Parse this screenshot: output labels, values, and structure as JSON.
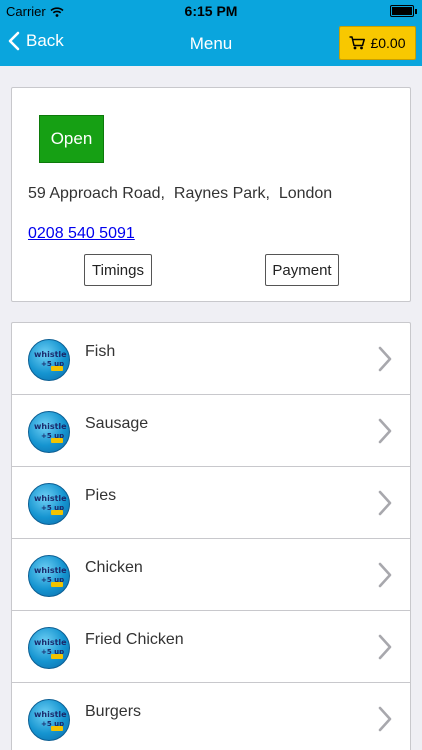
{
  "status_bar": {
    "carrier": "Carrier",
    "time": "6:15 PM"
  },
  "nav": {
    "back_label": "Back",
    "title": "Menu",
    "cart_total": "£0.00"
  },
  "shop": {
    "status": "Open",
    "address": "59 Approach Road,  Raynes Park,  London",
    "phone": "0208 540 5091",
    "timings_label": "Timings",
    "payment_label": "Payment"
  },
  "menu": {
    "items": [
      {
        "label": "Fish"
      },
      {
        "label": "Sausage"
      },
      {
        "label": "Pies"
      },
      {
        "label": "Chicken"
      },
      {
        "label": "Fried Chicken"
      },
      {
        "label": "Burgers"
      }
    ],
    "logo_text_line1": "whistle",
    "logo_text_line2": "+5 up"
  },
  "colors": {
    "nav_background": "#0aa5dd",
    "cart_button": "#f8c800",
    "open_badge": "#16a014",
    "phone_link": "#0000ee"
  },
  "icons": {
    "status_wifi": "wifi-icon",
    "back": "chevron-left-icon",
    "cart": "shopping-cart-icon",
    "row_disclosure": "chevron-right-icon",
    "row_logo": "whistle-logo-icon"
  }
}
